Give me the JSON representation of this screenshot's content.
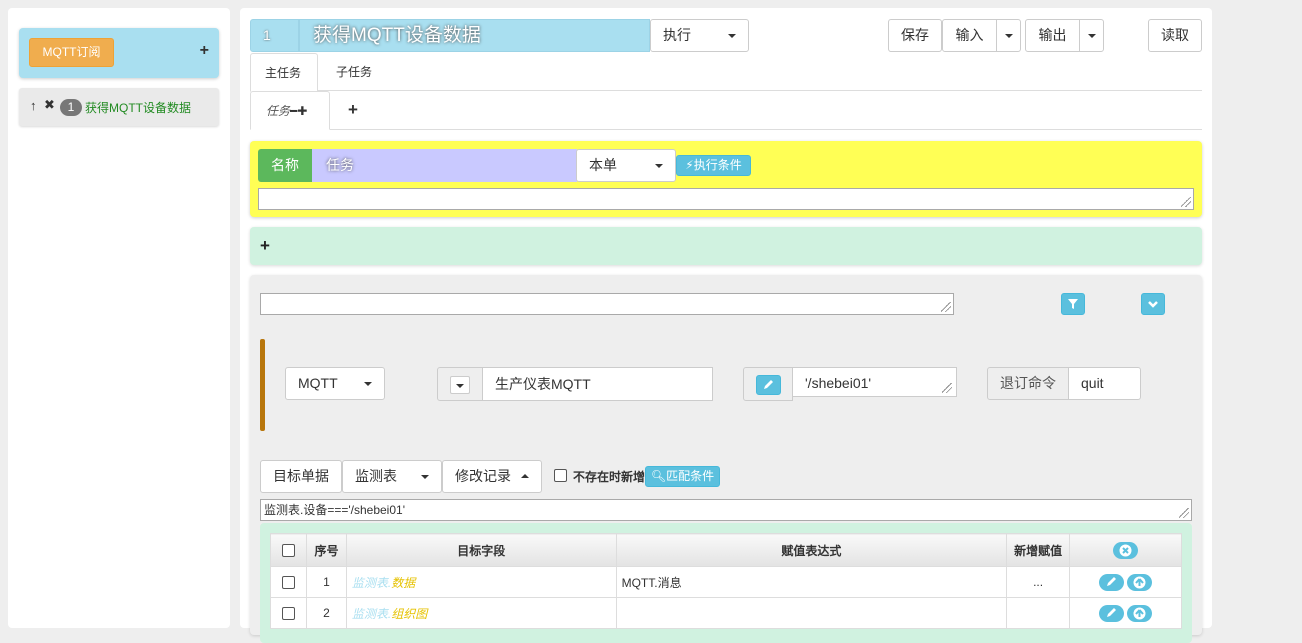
{
  "sidebar": {
    "subscribe_button": "MQTT订阅",
    "plus": "+",
    "item": {
      "up": "🠕",
      "delete": "✖",
      "badge": "1",
      "label": "获得MQTT设备数据"
    }
  },
  "header": {
    "number": "1",
    "title": "获得MQTT设备数据",
    "mode_select": "执行",
    "save": "保存",
    "input": "输入",
    "output": "输出",
    "read": "读取"
  },
  "tabs": [
    {
      "label": "主任务"
    },
    {
      "label": "子任务"
    }
  ],
  "subtabs": {
    "task_label": "任务",
    "minus": "━",
    "plus": "✚",
    "add": "+"
  },
  "task_panel": {
    "name_label": "名称",
    "name_value": "任务",
    "scope_select": "本单",
    "condition_button": "执行条件"
  },
  "green_panel": {
    "add": "+"
  },
  "step": {
    "protocol_select": "MQTT",
    "device_value": "生产仪表MQTT",
    "topic_value": "'/shebei01'",
    "unsubscribe_label": "退订命令",
    "unsubscribe_value": "quit",
    "target_button": "目标单据",
    "table_select": "监测表",
    "record_select": "修改记录",
    "no_exist_label": "不存在时新增",
    "match_button": "匹配条件",
    "match_expression": "监测表.设备==='/shebei01'"
  },
  "table": {
    "headers": [
      "序号",
      "目标字段",
      "赋值表达式",
      "新增赋值"
    ],
    "rows": [
      {
        "seq": "1",
        "field_a": "监测表.",
        "field_b": "数据",
        "expr": "MQTT.消息",
        "new": "..."
      },
      {
        "seq": "2",
        "field_a": "监测表.",
        "field_b": "组织图",
        "expr": "",
        "new": ""
      }
    ]
  },
  "colors": {
    "accent_blue": "#5bc0de",
    "title_blue": "#a9dff0",
    "yellow": "#ffff55",
    "green_panel": "#d0f2e0",
    "orange": "#f0ad4e",
    "success": "#5cb85c"
  }
}
